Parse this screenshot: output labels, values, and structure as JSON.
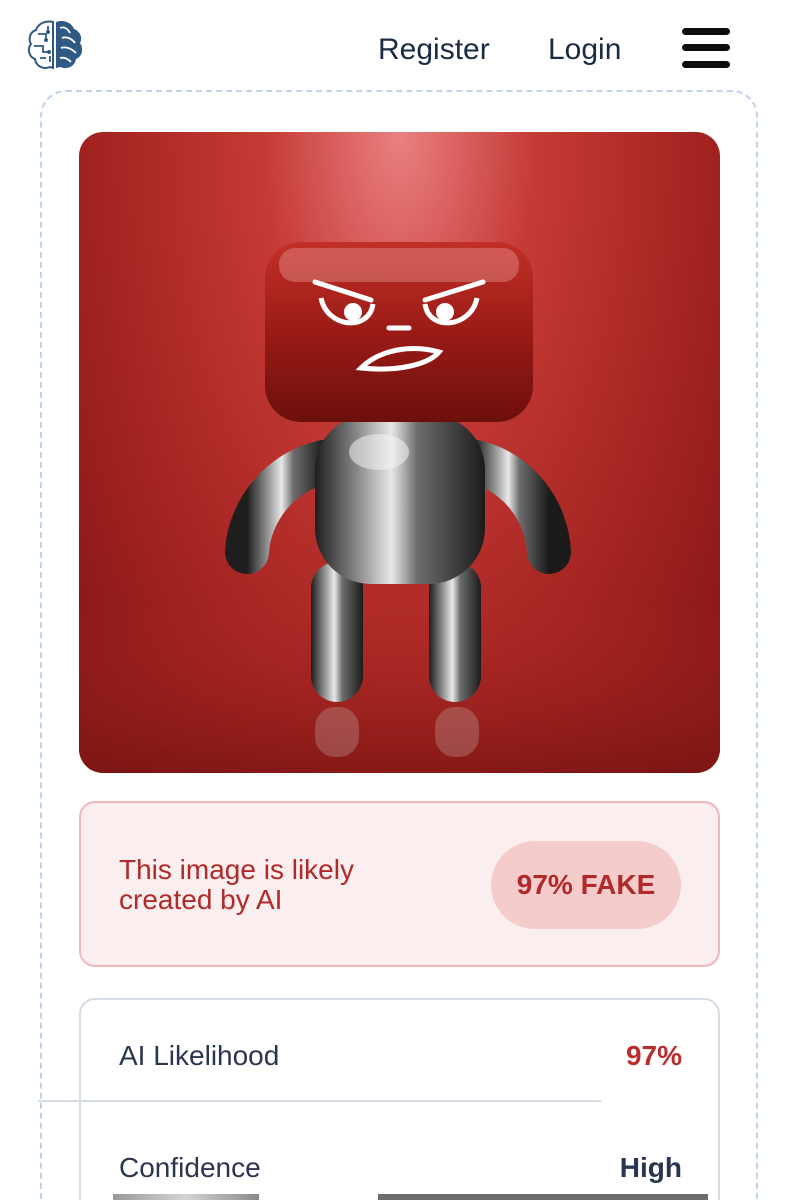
{
  "header": {
    "register_label": "Register",
    "login_label": "Login"
  },
  "result": {
    "verdict_text": "This image is likely created by AI",
    "badge": "97% FAKE"
  },
  "stats": [
    {
      "label": "AI Likelihood",
      "value": "97%"
    },
    {
      "label": "Confidence",
      "value": "High"
    }
  ],
  "colors": {
    "brand": "#2f5a85",
    "fake_red": "#b12a2a",
    "banner_bg": "#fbeeee",
    "badge_bg": "#f4cccc"
  },
  "icons": {
    "logo": "brain-icon",
    "menu": "hamburger-menu-icon"
  }
}
